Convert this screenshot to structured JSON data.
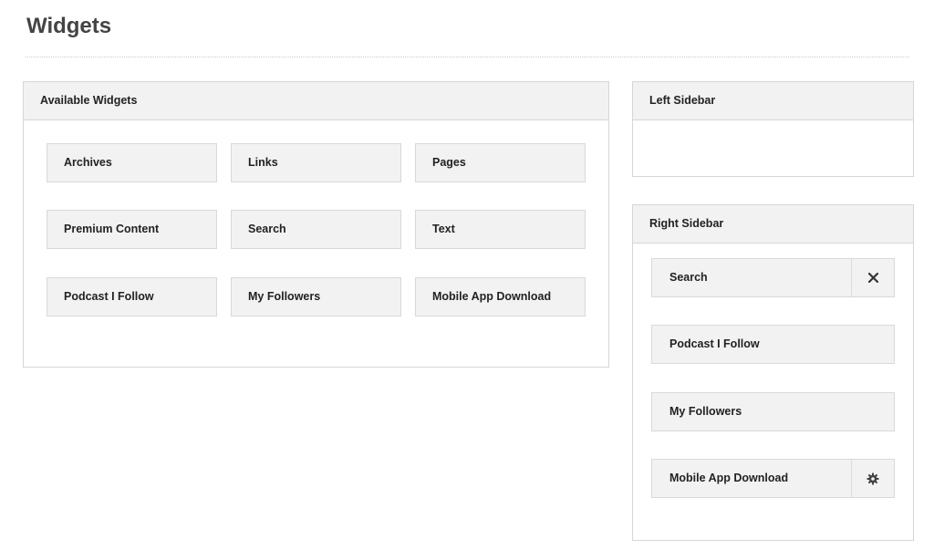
{
  "page": {
    "title": "Widgets"
  },
  "available": {
    "title": "Available Widgets",
    "widgets": [
      "Archives",
      "Links",
      "Pages",
      "Premium Content",
      "Search",
      "Text",
      "Podcast I Follow",
      "My Followers",
      "Mobile App Download"
    ]
  },
  "left_sidebar": {
    "title": "Left Sidebar",
    "items": []
  },
  "right_sidebar": {
    "title": "Right Sidebar",
    "items": [
      {
        "label": "Search",
        "action_icon": "close-icon"
      },
      {
        "label": "Podcast I Follow",
        "action_icon": null
      },
      {
        "label": "My Followers",
        "action_icon": null
      },
      {
        "label": "Mobile App Download",
        "action_icon": "gear-icon"
      }
    ]
  },
  "colors": {
    "panel_header_bg": "#f2f2f2",
    "border": "#d6d6d6",
    "title_text": "#444444"
  }
}
